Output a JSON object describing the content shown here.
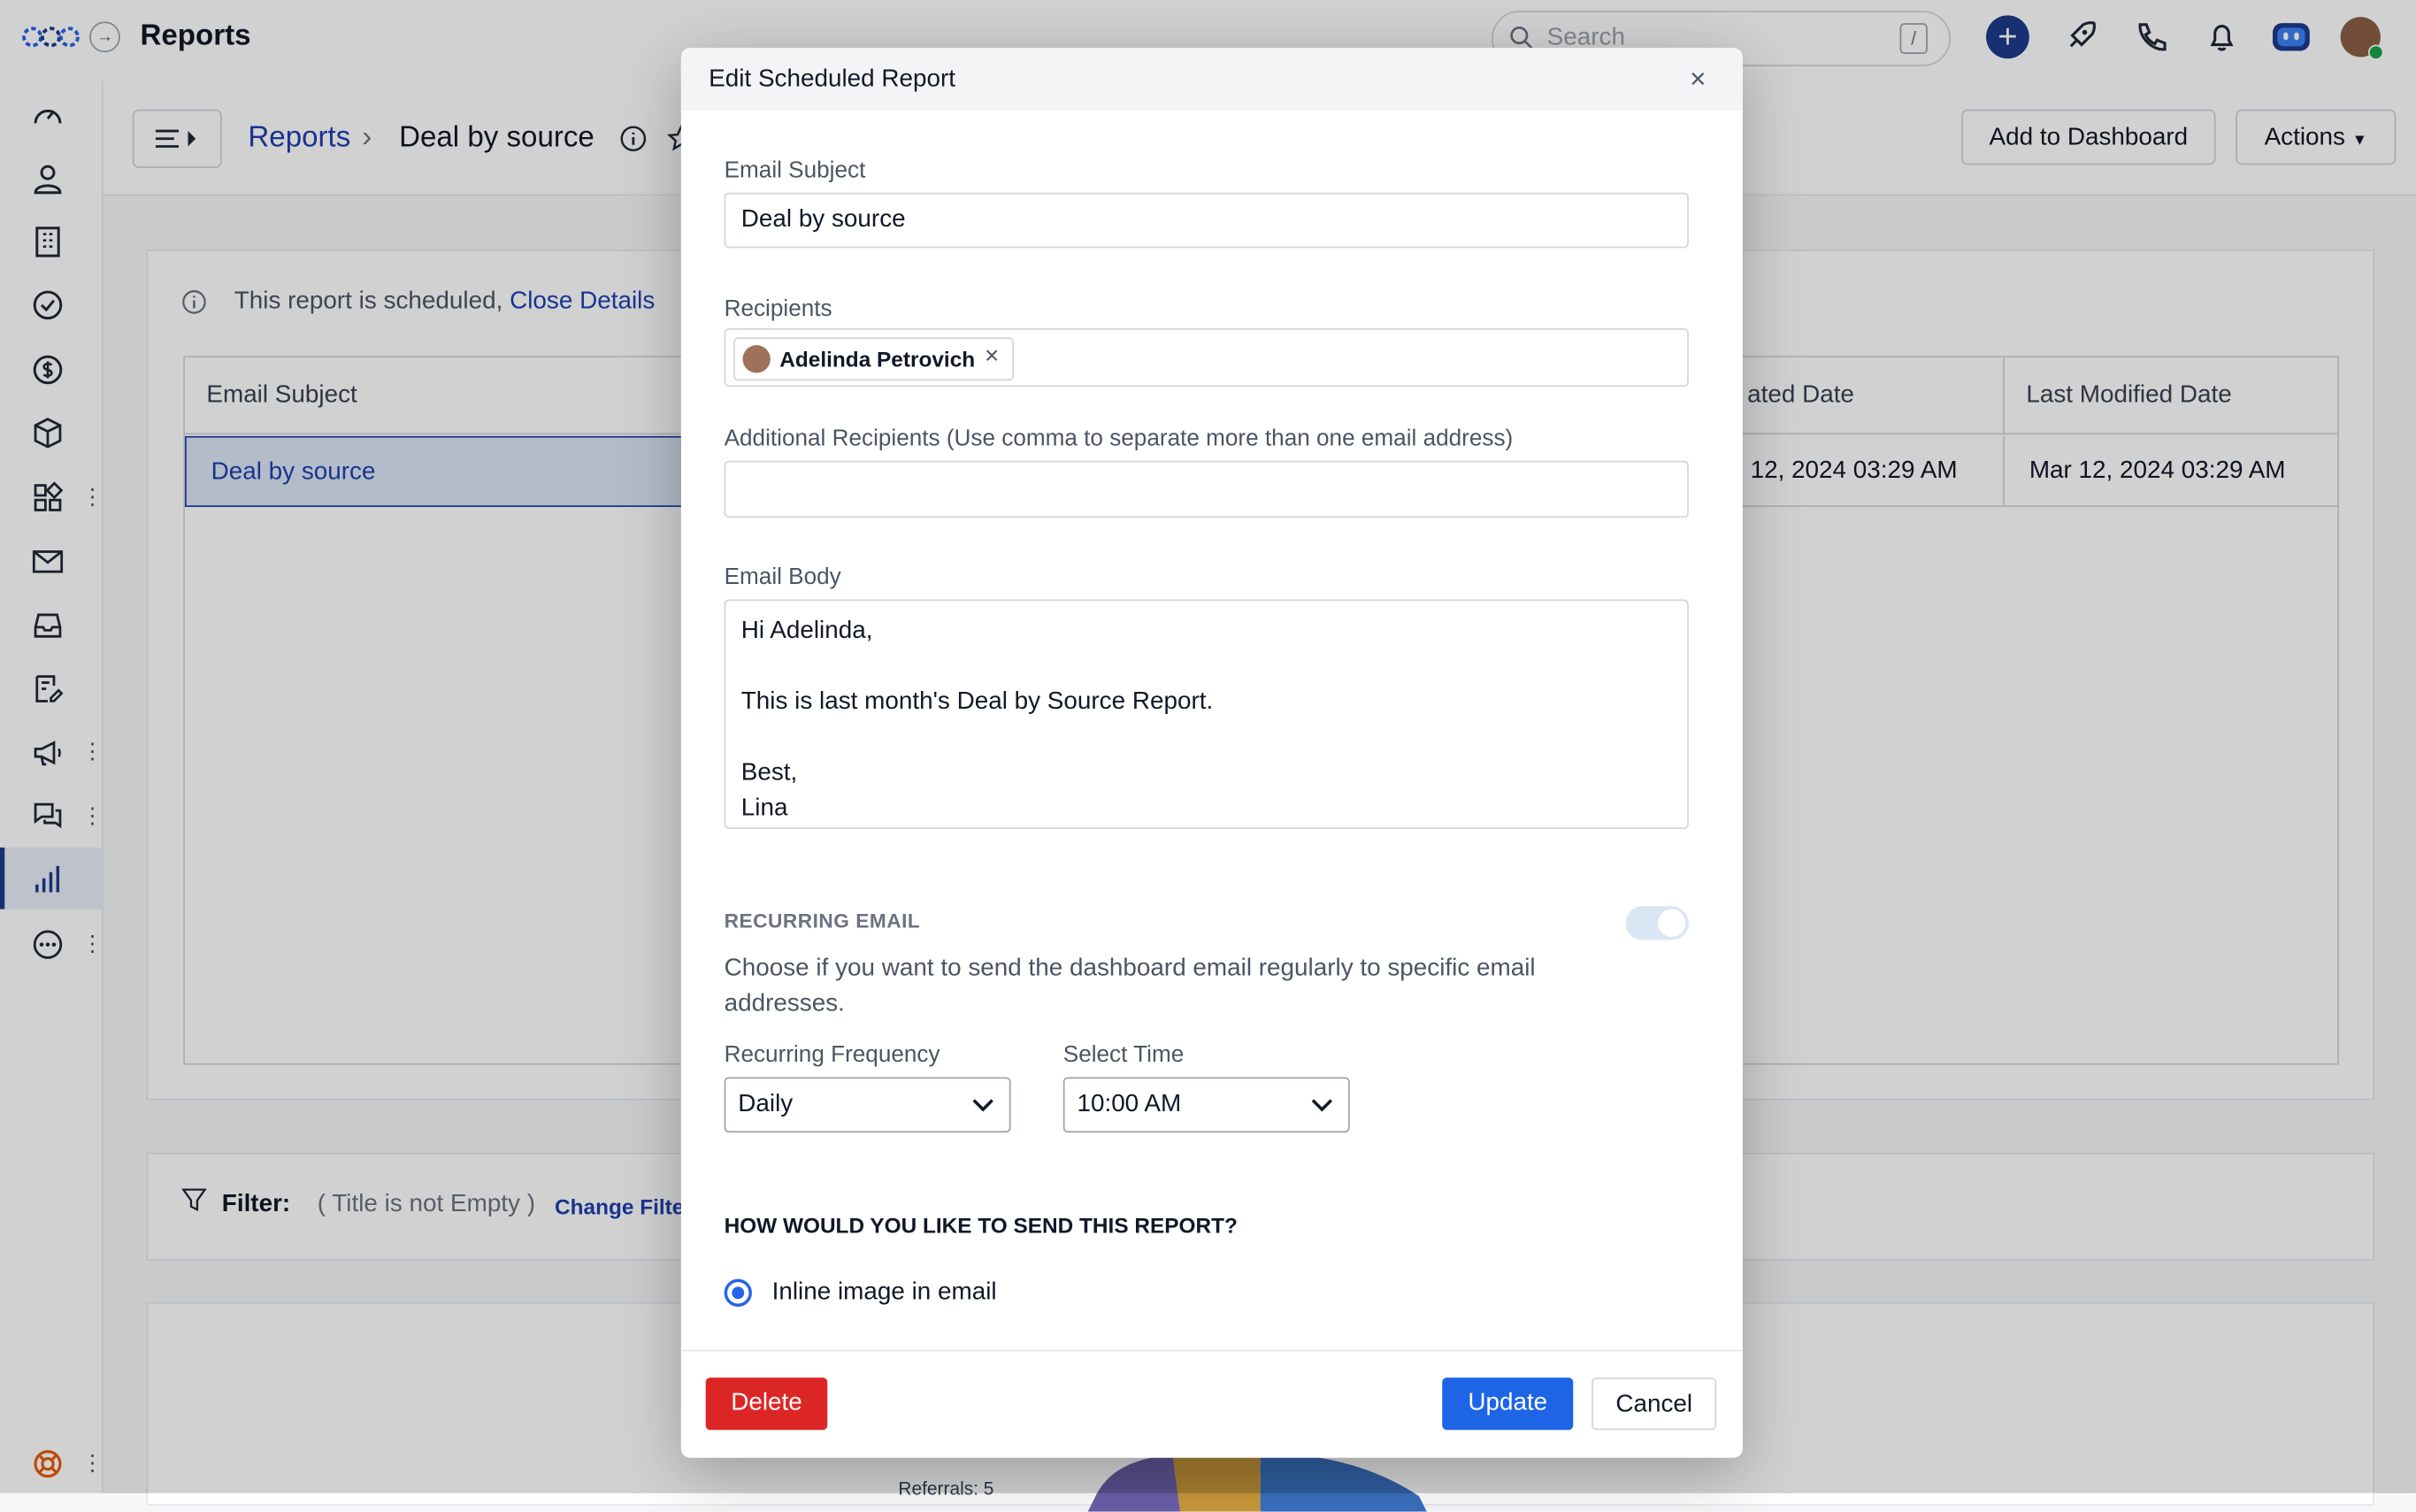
{
  "app": {
    "title": "Reports"
  },
  "search": {
    "placeholder": "Search",
    "shortcut": "/"
  },
  "breadcrumb": {
    "root": "Reports",
    "current": "Deal by source"
  },
  "header_actions": {
    "add_to_dashboard": "Add to Dashboard",
    "actions": "Actions"
  },
  "schedule_note": {
    "text": "This report is scheduled,",
    "link": "Close Details"
  },
  "table": {
    "headers": [
      "Email Subject",
      "ated Date",
      "Last Modified Date"
    ],
    "row": [
      "Deal by source",
      "12, 2024 03:29 AM",
      "Mar 12, 2024 03:29 AM"
    ]
  },
  "filter": {
    "label": "Filter:",
    "value": "( Title is not Empty )",
    "link": "Change Filte"
  },
  "chart_fragment": {
    "label": "Referrals: 5"
  },
  "modal": {
    "title": "Edit Scheduled Report",
    "email_subject_label": "Email Subject",
    "email_subject_value": "Deal by source",
    "recipients_label": "Recipients",
    "recipient_name": "Adelinda Petrovich",
    "additional_label": "Additional Recipients (Use comma to separate more than one email address)",
    "additional_value": "",
    "body_label": "Email Body",
    "body_value": "Hi Adelinda,\n\nThis is last month's Deal by Source Report.\n\nBest,\nLina",
    "recurring_heading": "RECURRING EMAIL",
    "recurring_desc": "Choose if you want to send the dashboard email regularly to specific email addresses.",
    "frequency_label": "Recurring Frequency",
    "frequency_value": "Daily",
    "time_label": "Select Time",
    "time_value": "10:00 AM",
    "send_heading": "HOW WOULD YOU LIKE TO SEND THIS REPORT?",
    "send_option": "Inline image in email",
    "delete_label": "Delete",
    "update_label": "Update",
    "cancel_label": "Cancel"
  },
  "colors": {
    "brand": "#1e3a8a",
    "link": "#1e40af",
    "danger": "#dc2626",
    "primary": "#1d64e6"
  }
}
